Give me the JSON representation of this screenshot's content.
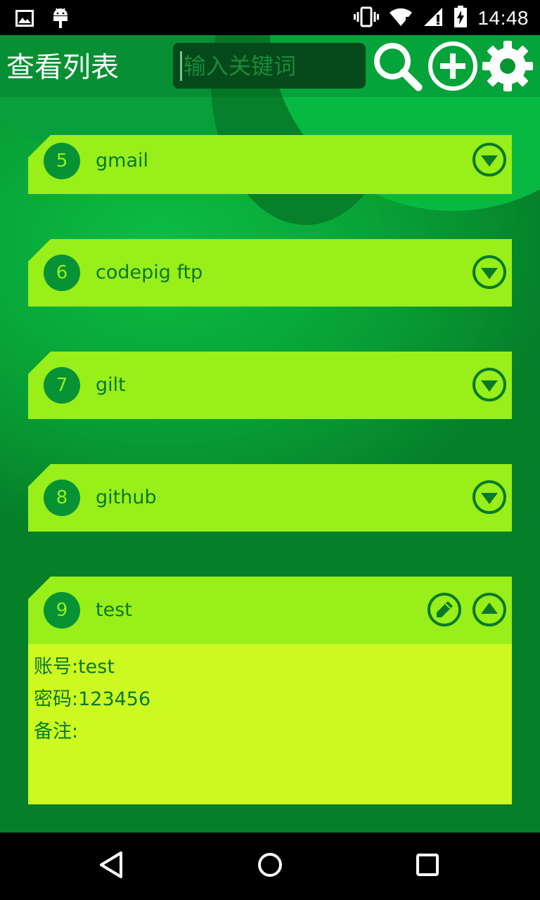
{
  "status_bar": {
    "time": "14:48",
    "left_icons": [
      "image-notification-icon",
      "android-notification-icon"
    ],
    "right_icons": [
      "vibrate-icon",
      "wifi-icon",
      "signal-icon",
      "battery-charging-icon"
    ]
  },
  "header": {
    "title": "查看列表",
    "search_placeholder": "输入关键词",
    "icons": [
      "search-icon",
      "add-circle-icon",
      "gear-icon"
    ]
  },
  "colors": {
    "background": "#07952f",
    "card_header": "#98ef19",
    "card_detail": "#ccf91f",
    "accent_dark": "#097a2a",
    "number_circle": "#079335"
  },
  "list": {
    "items": [
      {
        "number": "5",
        "name": "gmail",
        "expanded": false,
        "toggle_icon": "chevron-down-circle-icon"
      },
      {
        "number": "6",
        "name": "codepig ftp",
        "expanded": false,
        "toggle_icon": "chevron-down-circle-icon"
      },
      {
        "number": "7",
        "name": "gilt",
        "expanded": false,
        "toggle_icon": "chevron-down-circle-icon"
      },
      {
        "number": "8",
        "name": "github",
        "expanded": false,
        "toggle_icon": "chevron-down-circle-icon"
      },
      {
        "number": "9",
        "name": "test",
        "expanded": true,
        "toggle_icon": "chevron-up-circle-icon",
        "edit_icon": "pencil-icon",
        "detail": {
          "account": "账号:test",
          "password": "密码:123456",
          "note": "备注:"
        }
      }
    ]
  },
  "nav_bar": {
    "icons": [
      "back-icon",
      "home-icon",
      "recent-apps-icon"
    ]
  }
}
